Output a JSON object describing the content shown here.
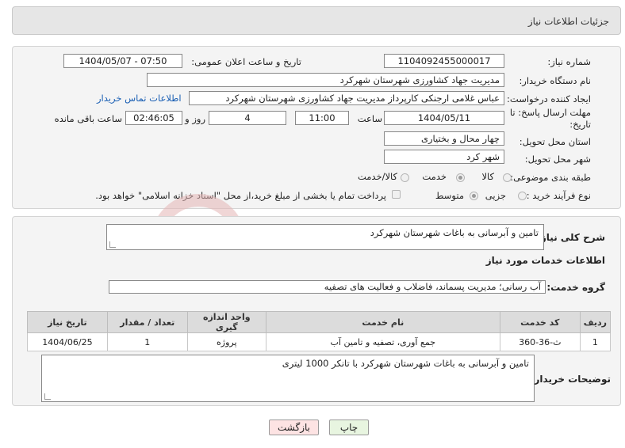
{
  "header": {
    "title": "جزئیات اطلاعات نیاز"
  },
  "form": {
    "need_number_label": "شماره نیاز:",
    "need_number": "1104092455000017",
    "announce_label": "تاریخ و ساعت اعلان عمومی:",
    "announce_value": "1404/05/07 - 07:50",
    "buyer_org_label": "نام دستگاه خریدار:",
    "buyer_org": "مدیریت جهاد کشاورزی شهرستان شهرکرد",
    "requester_label": "ایجاد کننده درخواست:",
    "requester": "عباس غلامی ارجنکی کارپرداز مدیریت جهاد کشاورزی شهرستان شهرکرد",
    "contact_link": "اطلاعات تماس خریدار",
    "deadline_label_1": "مهلت ارسال پاسخ: تا",
    "deadline_label_2": "تاریخ:",
    "deadline_date": "1404/05/11",
    "time_label": "ساعت",
    "deadline_time": "11:00",
    "days_value": "4",
    "days_label": "روز و",
    "remaining_time": "02:46:05",
    "remaining_label": "ساعت باقی مانده",
    "province_label": "استان محل تحویل:",
    "province": "چهار محال و بختیاری",
    "city_label": "شهر محل تحویل:",
    "city": "شهر کرد",
    "category_label": "طبقه بندی موضوعی:",
    "category_options": [
      "کالا",
      "خدمت",
      "کالا/خدمت"
    ],
    "category_selected": "خدمت",
    "process_label": "نوع فرآیند خرید :",
    "process_options": [
      "جزیی",
      "متوسط"
    ],
    "process_selected": "متوسط",
    "payment_note": "پرداخت تمام یا بخشی از مبلغ خرید،از محل \"اسناد خزانه اسلامی\" خواهد بود."
  },
  "details": {
    "summary_label": "شرح کلی نیاز:",
    "summary": "تامین و آبرسانی به باغات شهرستان شهرکرد",
    "services_heading": "اطلاعات خدمات مورد نیاز",
    "service_group_label": "گروه خدمت:",
    "service_group": "آب رسانی؛ مدیریت پسماند، فاضلاب و فعالیت های تصفیه",
    "table": {
      "headers": [
        "ردیف",
        "کد خدمت",
        "نام خدمت",
        "واحد اندازه گیری",
        "تعداد / مقدار",
        "تاریخ نیاز"
      ],
      "rows": [
        [
          "1",
          "ث-36-360",
          "جمع آوری، تصفیه و تامین آب",
          "پروژه",
          "1",
          "1404/06/25"
        ]
      ]
    },
    "buyer_notes_label": "توضیحات خریدار:",
    "buyer_notes": "تامین و آبرسانی به باغات شهرستان شهرکرد با تانکر 1000 لیتری"
  },
  "buttons": {
    "print": "چاپ",
    "back": "بازگشت"
  },
  "watermark_text": "AriaTender.neT",
  "colors": {
    "link": "#1a5fb4",
    "back_button": "#fde3e3",
    "print_button": "#e8f5e0",
    "watermark": "#e4b5b5"
  }
}
